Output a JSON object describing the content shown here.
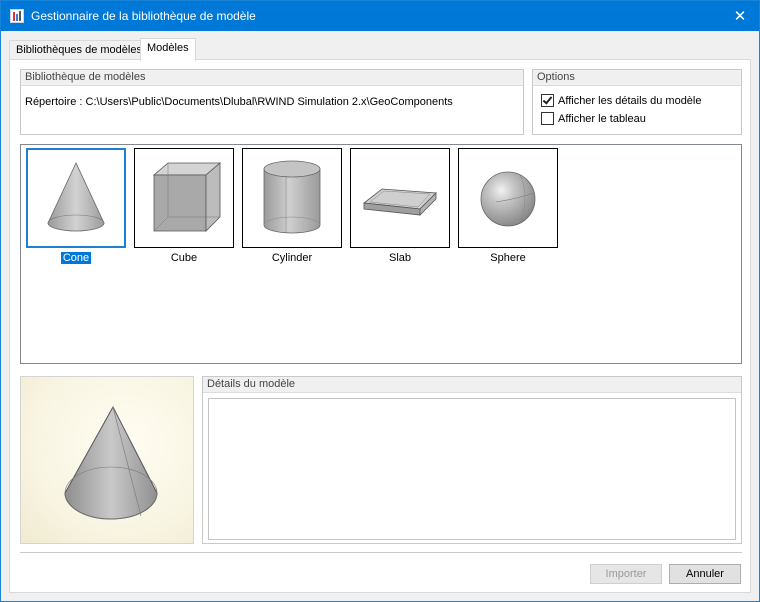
{
  "window": {
    "title": "Gestionnaire de la bibliothèque de modèle",
    "close_glyph": "✕"
  },
  "tabs": [
    {
      "label": "Bibliothèques de modèles",
      "active": false
    },
    {
      "label": "Modèles",
      "active": true
    }
  ],
  "library_group": {
    "title": "Bibliothèque de modèles",
    "directory_label": "Répertoire :",
    "directory_path": "C:\\Users\\Public\\Documents\\Dlubal\\RWIND Simulation 2.x\\GeoComponents"
  },
  "options_group": {
    "title": "Options",
    "show_details": {
      "label": "Afficher les détails du modèle",
      "checked": true
    },
    "show_table": {
      "label": "Afficher le tableau",
      "checked": false
    }
  },
  "models": [
    {
      "name": "Cone",
      "icon": "cone-icon",
      "selected": true
    },
    {
      "name": "Cube",
      "icon": "cube-icon",
      "selected": false
    },
    {
      "name": "Cylinder",
      "icon": "cylinder-icon",
      "selected": false
    },
    {
      "name": "Slab",
      "icon": "slab-icon",
      "selected": false
    },
    {
      "name": "Sphere",
      "icon": "sphere-icon",
      "selected": false
    }
  ],
  "details_group": {
    "title": "Détails du modèle"
  },
  "buttons": {
    "import_label": "Importer",
    "import_enabled": false,
    "cancel_label": "Annuler"
  },
  "colors": {
    "titlebar": "#0078d7",
    "selection": "#0078d7",
    "selection_border": "#1e7fd3",
    "preview_background": "#f9f5e3"
  }
}
